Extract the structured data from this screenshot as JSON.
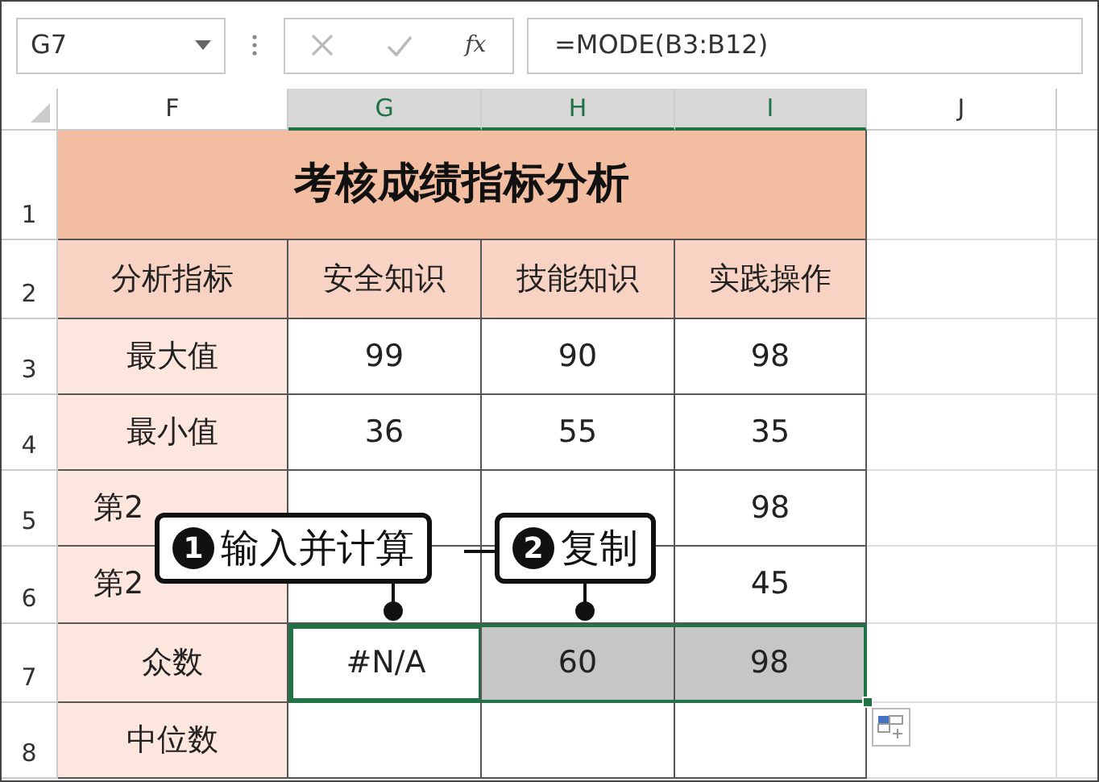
{
  "name_box": "G7",
  "formula_bar": {
    "fx": "fx",
    "formula": "=MODE(B3:B12)"
  },
  "columns": [
    {
      "label": "F",
      "selected": false
    },
    {
      "label": "G",
      "selected": true
    },
    {
      "label": "H",
      "selected": true
    },
    {
      "label": "I",
      "selected": true
    },
    {
      "label": "J",
      "selected": false
    }
  ],
  "title": {
    "row": "1",
    "text": "考核成绩指标分析"
  },
  "rows": [
    {
      "row": "2",
      "kind": "header",
      "cells": [
        {
          "text": "分析指标",
          "selected": false,
          "active": false
        },
        {
          "text": "安全知识",
          "selected": false,
          "active": false
        },
        {
          "text": "技能知识",
          "selected": false,
          "active": false
        },
        {
          "text": "实践操作",
          "selected": false,
          "active": false
        }
      ]
    },
    {
      "row": "3",
      "kind": "data",
      "cells": [
        {
          "text": "最大值",
          "selected": false,
          "active": false
        },
        {
          "text": "99",
          "selected": false,
          "active": false
        },
        {
          "text": "90",
          "selected": false,
          "active": false
        },
        {
          "text": "98",
          "selected": false,
          "active": false
        }
      ]
    },
    {
      "row": "4",
      "kind": "data",
      "cells": [
        {
          "text": "最小值",
          "selected": false,
          "active": false
        },
        {
          "text": "36",
          "selected": false,
          "active": false
        },
        {
          "text": "55",
          "selected": false,
          "active": false
        },
        {
          "text": "35",
          "selected": false,
          "active": false
        }
      ]
    },
    {
      "row": "5",
      "kind": "covered",
      "cells": [
        {
          "text": "第2",
          "selected": false,
          "active": false
        },
        {
          "selected": false,
          "active": false
        },
        {
          "selected": false,
          "active": false
        },
        {
          "text": "98",
          "selected": false,
          "active": false
        }
      ]
    },
    {
      "row": "6",
      "kind": "covered",
      "cells": [
        {
          "text": "第2",
          "selected": false,
          "active": false
        },
        {
          "selected": false,
          "active": false
        },
        {
          "selected": false,
          "active": false
        },
        {
          "text": "45",
          "selected": false,
          "active": false
        }
      ]
    },
    {
      "row": "7",
      "kind": "data",
      "cells": [
        {
          "text": "众数",
          "selected": false,
          "active": false
        },
        {
          "text": "#N/A",
          "selected": true,
          "active": true
        },
        {
          "text": "60",
          "selected": true,
          "active": false
        },
        {
          "text": "98",
          "selected": true,
          "active": false
        }
      ]
    },
    {
      "row": "8",
      "kind": "data",
      "cells": [
        {
          "text": "中位数",
          "selected": false,
          "active": false
        },
        {
          "selected": false,
          "active": false
        },
        {
          "selected": false,
          "active": false
        },
        {
          "selected": false,
          "active": false
        }
      ]
    }
  ],
  "callouts": [
    {
      "number": "1",
      "text": "输入并计算"
    },
    {
      "number": "2",
      "text": "复制"
    }
  ]
}
